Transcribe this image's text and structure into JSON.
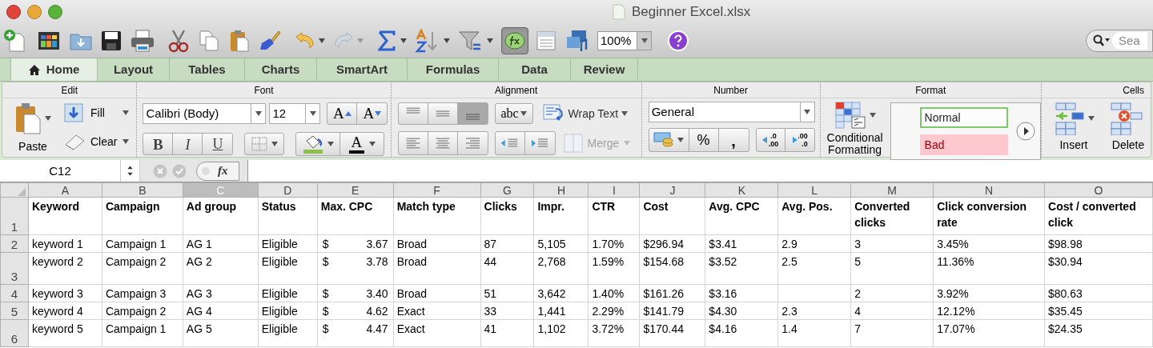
{
  "window": {
    "title": "Beginner Excel.xlsx"
  },
  "toolbar": {
    "formula_builder": {
      "selected": true
    },
    "zoom": "100%",
    "search": {
      "placeholder": "Sea"
    }
  },
  "tabs": [
    {
      "label": "Home",
      "selected": true
    },
    {
      "label": "Layout",
      "selected": false
    },
    {
      "label": "Tables",
      "selected": false
    },
    {
      "label": "Charts",
      "selected": false
    },
    {
      "label": "SmartArt",
      "selected": false
    },
    {
      "label": "Formulas",
      "selected": false
    },
    {
      "label": "Data",
      "selected": false
    },
    {
      "label": "Review",
      "selected": false
    }
  ],
  "ribbon": {
    "edit": {
      "title": "Edit",
      "paste": "Paste",
      "fill": "Fill",
      "clear": "Clear"
    },
    "font": {
      "title": "Font",
      "font_name": "Calibri (Body)",
      "font_size": "12",
      "grow": "A",
      "shrink": "A",
      "bold": "B",
      "italic": "I",
      "underline": "U",
      "font_color": "A"
    },
    "alignment": {
      "title": "Alignment",
      "orientation": "abc",
      "wrap_text": "Wrap Text",
      "merge": {
        "label": "Merge",
        "disabled": true
      }
    },
    "number": {
      "title": "Number",
      "format": "General",
      "percent": "%",
      "comma": ",",
      "decimal_left": [
        ".0",
        ".00"
      ],
      "decimal_right": [
        ".00",
        ".0"
      ]
    },
    "format": {
      "title": "Format",
      "conditional_formatting": "Conditional Formatting",
      "styles": [
        {
          "label": "Normal",
          "kind": "normal"
        },
        {
          "label": "Bad",
          "kind": "bad"
        }
      ]
    },
    "cells": {
      "title": "Cells",
      "insert": "Insert",
      "delete": "Delete"
    }
  },
  "formula_bar": {
    "name_box": "C12",
    "function_label": "fx"
  },
  "sheet": {
    "columns": [
      {
        "letter": "A",
        "selected": false
      },
      {
        "letter": "B",
        "selected": false
      },
      {
        "letter": "C",
        "selected": true
      },
      {
        "letter": "D",
        "selected": false
      },
      {
        "letter": "E",
        "selected": false
      },
      {
        "letter": "F",
        "selected": false
      },
      {
        "letter": "G",
        "selected": false
      },
      {
        "letter": "H",
        "selected": false
      },
      {
        "letter": "I",
        "selected": false
      },
      {
        "letter": "J",
        "selected": false
      },
      {
        "letter": "K",
        "selected": false
      },
      {
        "letter": "L",
        "selected": false
      },
      {
        "letter": "M",
        "selected": false
      },
      {
        "letter": "N",
        "selected": false
      },
      {
        "letter": "O",
        "selected": false
      }
    ],
    "rows": [
      {
        "number": "1",
        "kind": "header",
        "cells": [
          "Keyword",
          "Campaign",
          "Ad group",
          "Status",
          "Max. CPC",
          "Match type",
          "Clicks",
          "Impr.",
          "CTR",
          "Cost",
          "Avg. CPC",
          "Avg. Pos.",
          "Converted clicks",
          "Click conversion rate",
          "Cost / converted click"
        ]
      },
      {
        "number": "2",
        "kind": "data",
        "cells": [
          "keyword 1",
          "Campaign 1",
          "AG 1",
          "Eligible",
          {
            "symbol": "$",
            "amount": "3.67"
          },
          "Broad",
          "87",
          "5,105",
          "1.70%",
          "$296.94",
          "$3.41",
          "2.9",
          "3",
          "3.45%",
          "$98.98"
        ]
      },
      {
        "number": "3",
        "kind": "data",
        "cells": [
          "keyword 2",
          "Campaign 2",
          "AG 2",
          "Eligible",
          {
            "symbol": "$",
            "amount": "3.78"
          },
          "Broad",
          "44",
          "2,768",
          "1.59%",
          "$154.68",
          "$3.52",
          "2.5",
          "5",
          "11.36%",
          "$30.94"
        ]
      },
      {
        "number": "4",
        "kind": "data",
        "cells": [
          "keyword 3",
          "Campaign 3",
          "AG 3",
          "Eligible",
          {
            "symbol": "$",
            "amount": "3.40"
          },
          "Broad",
          "51",
          "3,642",
          "1.40%",
          "$161.26",
          "$3.16",
          null,
          "2",
          "3.92%",
          "$80.63"
        ]
      },
      {
        "number": "5",
        "kind": "data",
        "cells": [
          "keyword 4",
          "Campaign 2",
          "AG 4",
          "Eligible",
          {
            "symbol": "$",
            "amount": "4.62"
          },
          "Exact",
          "33",
          "1,441",
          "2.29%",
          "$141.79",
          "$4.30",
          "2.3",
          "4",
          "12.12%",
          "$35.45"
        ]
      },
      {
        "number": "6",
        "kind": "data",
        "cells": [
          "keyword 5",
          "Campaign 1",
          "AG 5",
          "Eligible",
          {
            "symbol": "$",
            "amount": "4.47"
          },
          "Exact",
          "41",
          "1,102",
          "3.72%",
          "$170.44",
          "$4.16",
          "1.4",
          "7",
          "17.07%",
          "$24.35"
        ]
      }
    ]
  }
}
